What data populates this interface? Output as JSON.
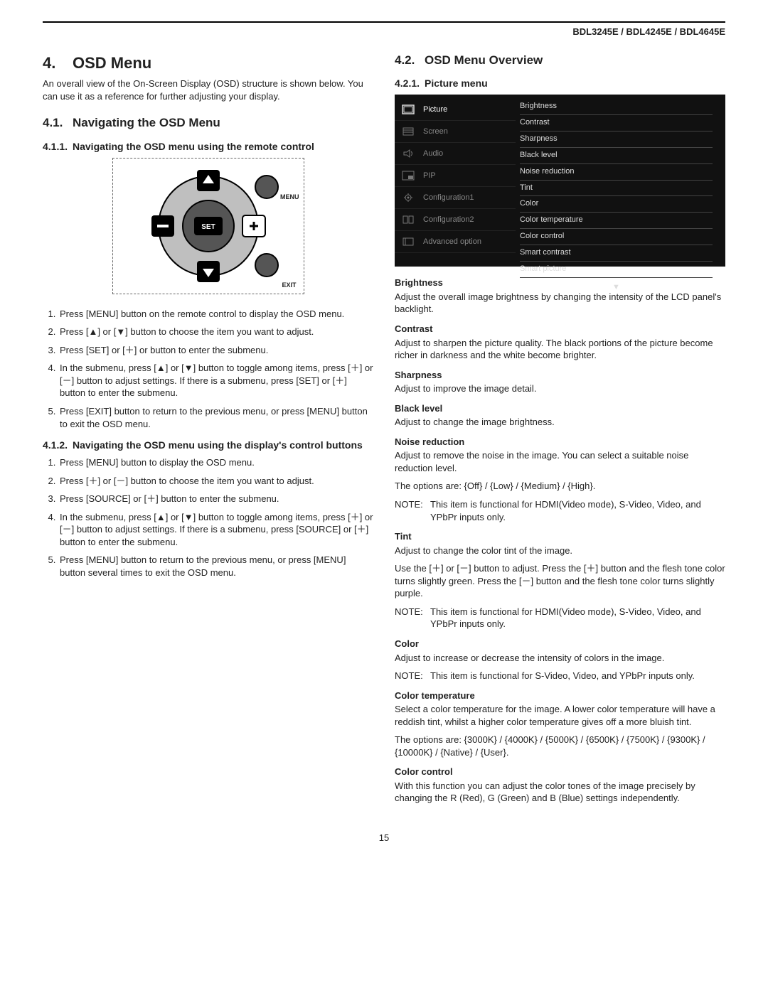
{
  "header": "BDL3245E / BDL4245E / BDL4645E",
  "page_number": "15",
  "left": {
    "h1_num": "4.",
    "h1": "OSD Menu",
    "intro": "An overall view of the On-Screen Display (OSD) structure is shown below. You can use it as a reference for further adjusting your display.",
    "h2_num": "4.1.",
    "h2": "Navigating  the OSD Menu",
    "h3a_num": "4.1.1.",
    "h3a": "Navigating the OSD menu using the remote control",
    "remote_labels": {
      "menu": "MENU",
      "set": "SET",
      "exit": "EXIT"
    },
    "steps_a": [
      "Press [MENU] button on the remote control to display the OSD menu.",
      "Press [▲] or [▼] button to choose the item you want to adjust.",
      "Press [SET] or [＋] or  button to enter the submenu.",
      "In the submenu, press [▲] or [▼] button to toggle among items, press [＋] or [－] button to adjust settings. If there is a submenu, press [SET] or [＋] button to enter the submenu.",
      "Press [EXIT] button to return to the previous menu, or press [MENU] button to exit the OSD menu."
    ],
    "h3b_num": "4.1.2.",
    "h3b": "Navigating the OSD menu using the display's control buttons",
    "steps_b": [
      "Press [MENU] button to display the OSD menu.",
      "Press [＋] or [－] button to choose the item you want to adjust.",
      "Press [SOURCE] or [＋] button to enter the submenu.",
      "In the submenu, press [▲] or [▼] button to toggle among items, press [＋] or [－] button to adjust settings. If there is a submenu, press [SOURCE] or [＋] button to enter the submenu.",
      "Press [MENU] button to return to the previous menu, or press [MENU] button several times to exit the OSD menu."
    ]
  },
  "right": {
    "h2_num": "4.2.",
    "h2": "OSD Menu Overview",
    "h3_num": "4.2.1.",
    "h3": "Picture menu",
    "osd_left_items": [
      "Picture",
      "Screen",
      "Audio",
      "PIP",
      "Configuration1",
      "Configuration2",
      "Advanced option"
    ],
    "osd_right_items": [
      "Brightness",
      "Contrast",
      "Sharpness",
      "Black level",
      "Noise reduction",
      "Tint",
      "Color",
      "Color temperature",
      "Color control",
      "Smart contrast",
      "Smart picture"
    ],
    "defs": [
      {
        "title": "Brightness",
        "body": "Adjust the overall image brightness by changing the intensity of the LCD panel's backlight."
      },
      {
        "title": "Contrast",
        "body": "Adjust to sharpen the picture quality. The black portions of the picture become richer in darkness and the white become brighter."
      },
      {
        "title": "Sharpness",
        "body": "Adjust to improve the image detail."
      },
      {
        "title": "Black level",
        "body": "Adjust to change the image brightness."
      }
    ],
    "noise": {
      "title": "Noise reduction",
      "body": "Adjust to remove the noise in the image. You can select a suitable noise reduction level.",
      "options": "The options are: {Off} / {Low} / {Medium} / {High}.",
      "note": "This item is functional for HDMI(Video mode), S-Video, Video, and YPbPr inputs only."
    },
    "tint": {
      "title": "Tint",
      "body": "Adjust to change the color tint of the image.",
      "body2": "Use the [＋] or [－] button to adjust. Press the [＋] button and the flesh tone color turns slightly green. Press the [－] button and the flesh tone color turns slightly purple.",
      "note": "This item is functional for HDMI(Video mode), S-Video, Video, and YPbPr inputs only."
    },
    "color": {
      "title": "Color",
      "body": "Adjust to increase or decrease the intensity of colors in the image.",
      "note": "This item is functional for S-Video, Video, and YPbPr inputs only."
    },
    "colortemp": {
      "title": "Color temperature",
      "body": "Select a color temperature for the image. A lower color temperature will have a reddish tint, whilst a higher color temperature gives off a more bluish tint.",
      "options": "The options are: {3000K} / {4000K} / {5000K} / {6500K} / {7500K} / {9300K} / {10000K} / {Native} / {User}."
    },
    "colorctrl": {
      "title": "Color control",
      "body": "With this function you can adjust the color tones of the image precisely by changing the R (Red), G (Green) and B (Blue) settings independently."
    },
    "note_label": "NOTE:"
  }
}
